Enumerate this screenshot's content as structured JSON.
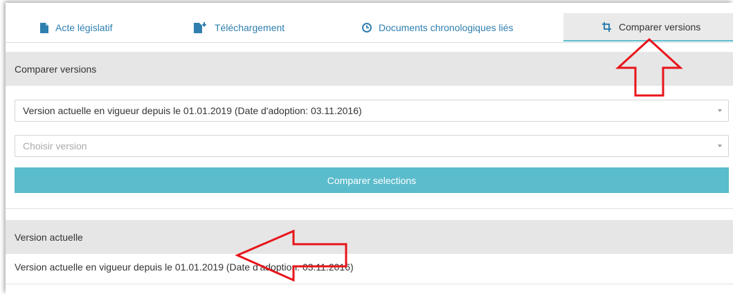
{
  "tabs": [
    {
      "label": "Acte législatif",
      "icon": "document-icon",
      "active": false
    },
    {
      "label": "Téléchargement",
      "icon": "download-file-icon",
      "active": false
    },
    {
      "label": "Documents chronologiques liés",
      "icon": "clock-icon",
      "active": false
    },
    {
      "label": "Comparer versions",
      "icon": "compare-icon",
      "active": true
    }
  ],
  "compare": {
    "header": "Comparer versions",
    "select1_value": "Version actuelle en vigueur depuis le 01.01.2019 (Date d'adoption: 03.11.2016)",
    "select2_placeholder": "Choisir version",
    "button_label": "Comparer selections"
  },
  "current": {
    "header": "Version actuelle",
    "text": "Version actuelle en vigueur depuis le 01.01.2019 (Date d'adoption: 03.11.2016)"
  },
  "colors": {
    "accent": "#5bbccc",
    "tab_link": "#2f7fb0",
    "panel_header": "#e6e6e6",
    "annotation_arrow": "#e8141b"
  }
}
